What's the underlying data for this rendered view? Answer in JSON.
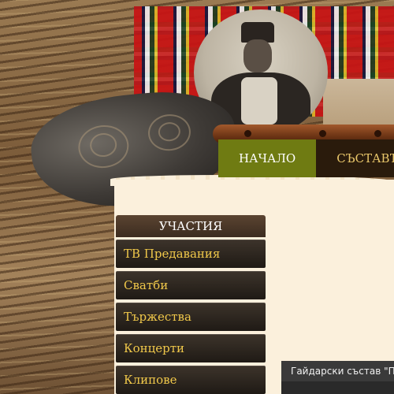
{
  "nav": {
    "items": [
      {
        "label": "НАЧАЛО",
        "active": true
      },
      {
        "label": "СЪСТАВЪТ",
        "active": false
      }
    ]
  },
  "sidebar": {
    "title": "УЧАСТИЯ",
    "items": [
      {
        "label": "ТВ Предавания"
      },
      {
        "label": "Сватби"
      },
      {
        "label": "Тържества"
      },
      {
        "label": "Концерти"
      },
      {
        "label": "Клипове"
      }
    ]
  },
  "video": {
    "caption": "Гайдарски състав \"Пе"
  },
  "colors": {
    "nav_active_bg": "#6f7b12",
    "nav_text": "#e8c66a",
    "menu_text": "#f0c84a",
    "content_bg": "#fbf0dc"
  }
}
